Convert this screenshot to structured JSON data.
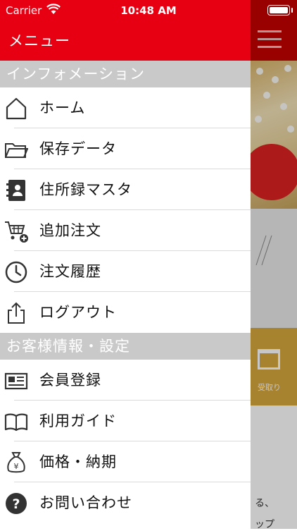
{
  "status_bar": {
    "carrier": "Carrier",
    "time": "10:48 AM"
  },
  "drawer": {
    "title": "メニュー",
    "sections": [
      {
        "title": "インフォメーション",
        "items": [
          {
            "label": "ホーム",
            "icon": "home-icon"
          },
          {
            "label": "保存データ",
            "icon": "folder-icon"
          },
          {
            "label": "住所録マスタ",
            "icon": "address-book-icon"
          },
          {
            "label": "追加注文",
            "icon": "cart-add-icon"
          },
          {
            "label": "注文履歴",
            "icon": "clock-icon"
          },
          {
            "label": "ログアウト",
            "icon": "share-out-icon"
          }
        ]
      },
      {
        "title": "お客様情報・設定",
        "items": [
          {
            "label": "会員登録",
            "icon": "id-card-icon"
          },
          {
            "label": "利用ガイド",
            "icon": "book-icon"
          },
          {
            "label": "価格・納期",
            "icon": "money-bag-icon"
          },
          {
            "label": "お問い合わせ",
            "icon": "question-icon"
          }
        ]
      }
    ]
  },
  "background": {
    "card_label": "受取り",
    "lower_text_1": "る、",
    "lower_text_2": "ップ"
  },
  "colors": {
    "header_red": "#e60012",
    "section_gray": "#c9c9c9"
  }
}
